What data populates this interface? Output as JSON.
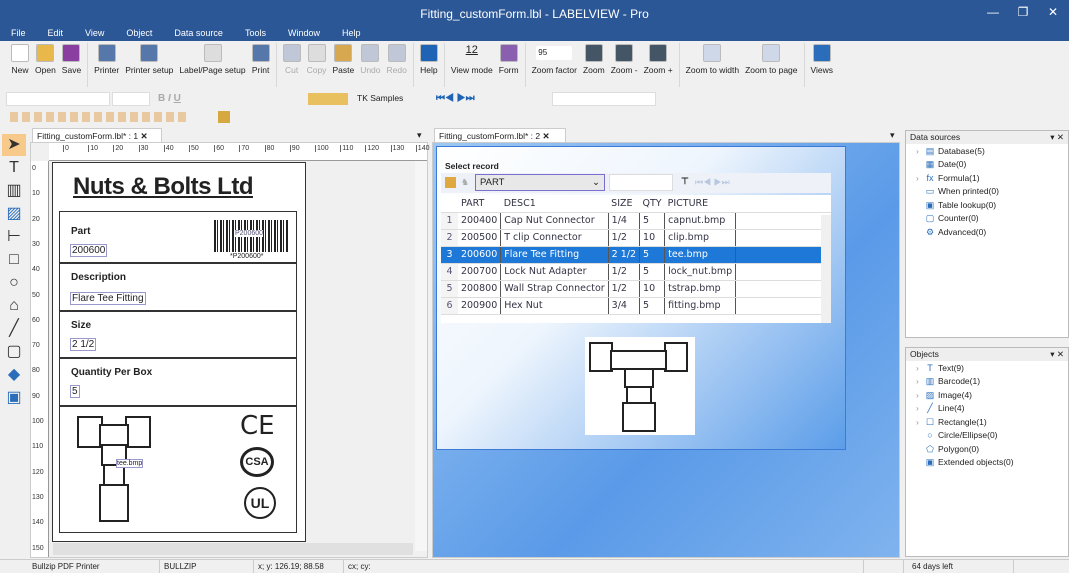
{
  "window": {
    "title": "Fitting_customForm.lbl - LABELVIEW - Pro"
  },
  "menu": [
    "File",
    "Edit",
    "View",
    "Object",
    "Data source",
    "Tools",
    "Window",
    "Help"
  ],
  "toolbar": [
    {
      "label": "New",
      "icon": "new-file-icon",
      "color": "#ffffff"
    },
    {
      "label": "Open",
      "icon": "open-folder-icon",
      "color": "#e8b84a"
    },
    {
      "label": "Save",
      "icon": "save-icon",
      "color": "#8a3fa0"
    },
    {
      "label": "Printer",
      "icon": "printer-icon",
      "color": "#5577aa"
    },
    {
      "label": "Printer setup",
      "icon": "printer-setup-icon",
      "color": "#5577aa"
    },
    {
      "label": "Label/Page setup",
      "icon": "page-setup-icon",
      "color": "#dddddd"
    },
    {
      "label": "Print",
      "icon": "print-icon",
      "color": "#5577aa"
    },
    {
      "label": "Cut",
      "icon": "cut-icon",
      "color": "#c0c8d8",
      "disabled": true
    },
    {
      "label": "Copy",
      "icon": "copy-icon",
      "color": "#dddddd",
      "disabled": true
    },
    {
      "label": "Paste",
      "icon": "paste-icon",
      "color": "#d8a850"
    },
    {
      "label": "Undo",
      "icon": "undo-icon",
      "color": "#c0c8d8",
      "disabled": true
    },
    {
      "label": "Redo",
      "icon": "redo-icon",
      "color": "#c0c8d8",
      "disabled": true
    },
    {
      "label": "Help",
      "icon": "help-icon",
      "color": "#1e63b4"
    },
    {
      "label": "View mode",
      "icon": "view-mode-icon",
      "color": "#eeeeee"
    },
    {
      "label": "Form",
      "icon": "form-icon",
      "color": "#8a5fb0"
    },
    {
      "label": "Zoom factor",
      "icon": "zoom-factor-combo",
      "color": "#ffffff"
    },
    {
      "label": "Zoom",
      "icon": "zoom-icon",
      "color": "#445566"
    },
    {
      "label": "Zoom -",
      "icon": "zoom-out-icon",
      "color": "#445566"
    },
    {
      "label": "Zoom +",
      "icon": "zoom-in-icon",
      "color": "#445566"
    },
    {
      "label": "Zoom to width",
      "icon": "zoom-width-icon",
      "color": "#cfd8e8"
    },
    {
      "label": "Zoom to page",
      "icon": "zoom-page-icon",
      "color": "#cfd8e8"
    },
    {
      "label": "Views",
      "icon": "views-icon",
      "color": "#2a6ebb"
    }
  ],
  "view_mode_value": "12",
  "zoom_factor": "95",
  "toolbar2": {
    "datasource_combo": "TK Samples"
  },
  "left_doc": {
    "tab": "Fitting_customForm.lbl* : 1",
    "ruler": [
      "0",
      "10",
      "20",
      "30",
      "40",
      "50",
      "60",
      "70",
      "80",
      "90",
      "100",
      "110",
      "120",
      "130",
      "140"
    ],
    "vruler": [
      "0",
      "10",
      "20",
      "30",
      "40",
      "50",
      "60",
      "70",
      "80",
      "90",
      "100",
      "110",
      "120",
      "130",
      "140",
      "150"
    ]
  },
  "label": {
    "company": "Nuts & Bolts Ltd",
    "part_label": "Part",
    "part_value": "200600",
    "barcode_text": "*P200600*",
    "barcode_inner": "P200600",
    "desc_label": "Description",
    "desc_value": "Flare Tee Fitting",
    "size_label": "Size",
    "size_value": "2 1/2",
    "qty_label": "Quantity Per Box",
    "qty_value": "5",
    "image_caption": "tee.bmp",
    "ce": "CE",
    "csa": "CSA",
    "ul": "UL"
  },
  "right_doc": {
    "tab": "Fitting_customForm.lbl* : 2",
    "select_record": "Select record",
    "field_combo": "PART",
    "search_value": "",
    "columns": [
      "PART",
      "DESC1",
      "SIZE",
      "QTY",
      "PICTURE"
    ],
    "rows": [
      [
        "1",
        "200400",
        "Cap Nut Connector",
        "1/4",
        "5",
        "capnut.bmp"
      ],
      [
        "2",
        "200500",
        "T clip Connector",
        "1/2",
        "10",
        "clip.bmp"
      ],
      [
        "3",
        "200600",
        "Flare Tee Fitting",
        "2 1/2",
        "5",
        "tee.bmp"
      ],
      [
        "4",
        "200700",
        "Lock Nut Adapter",
        "1/2",
        "5",
        "lock_nut.bmp"
      ],
      [
        "5",
        "200800",
        "Wall Strap Connector",
        "1/2",
        "10",
        "tstrap.bmp"
      ],
      [
        "6",
        "200900",
        "Hex Nut",
        "3/4",
        "5",
        "fitting.bmp"
      ]
    ],
    "selected_row": 2
  },
  "data_sources": {
    "title": "Data sources",
    "items": [
      {
        "label": "Database(5)",
        "icon": "database-icon",
        "glyph": "▤",
        "expand": true
      },
      {
        "label": "Date(0)",
        "icon": "date-icon",
        "glyph": "▦"
      },
      {
        "label": "Formula(1)",
        "icon": "formula-icon",
        "glyph": "fx",
        "expand": true
      },
      {
        "label": "When printed(0)",
        "icon": "when-printed-icon",
        "glyph": "▭"
      },
      {
        "label": "Table lookup(0)",
        "icon": "table-lookup-icon",
        "glyph": "▣"
      },
      {
        "label": "Counter(0)",
        "icon": "counter-icon",
        "glyph": "▢"
      },
      {
        "label": "Advanced(0)",
        "icon": "advanced-icon",
        "glyph": "⚙"
      }
    ]
  },
  "objects": {
    "title": "Objects",
    "items": [
      {
        "label": "Text(9)",
        "icon": "text-icon",
        "glyph": "T",
        "expand": true
      },
      {
        "label": "Barcode(1)",
        "icon": "barcode-icon",
        "glyph": "▥",
        "expand": true
      },
      {
        "label": "Image(4)",
        "icon": "image-icon",
        "glyph": "▨",
        "expand": true
      },
      {
        "label": "Line(4)",
        "icon": "line-icon",
        "glyph": "╱",
        "expand": true
      },
      {
        "label": "Rectangle(1)",
        "icon": "rectangle-icon",
        "glyph": "☐",
        "expand": true
      },
      {
        "label": "Circle/Ellipse(0)",
        "icon": "circle-icon",
        "glyph": "○"
      },
      {
        "label": "Polygon(0)",
        "icon": "polygon-icon",
        "glyph": "⬠"
      },
      {
        "label": "Extended objects(0)",
        "icon": "extended-objects-icon",
        "glyph": "▣"
      }
    ]
  },
  "status": {
    "printer": "Bullzip PDF Printer",
    "port": "BULLZIP",
    "xy": "x; y: 126.19; 88.58",
    "cxcy": "cx; cy:",
    "trial": "64 days left"
  },
  "colors": {
    "titlebar": "#2b5797",
    "selection": "#1e78d8"
  }
}
